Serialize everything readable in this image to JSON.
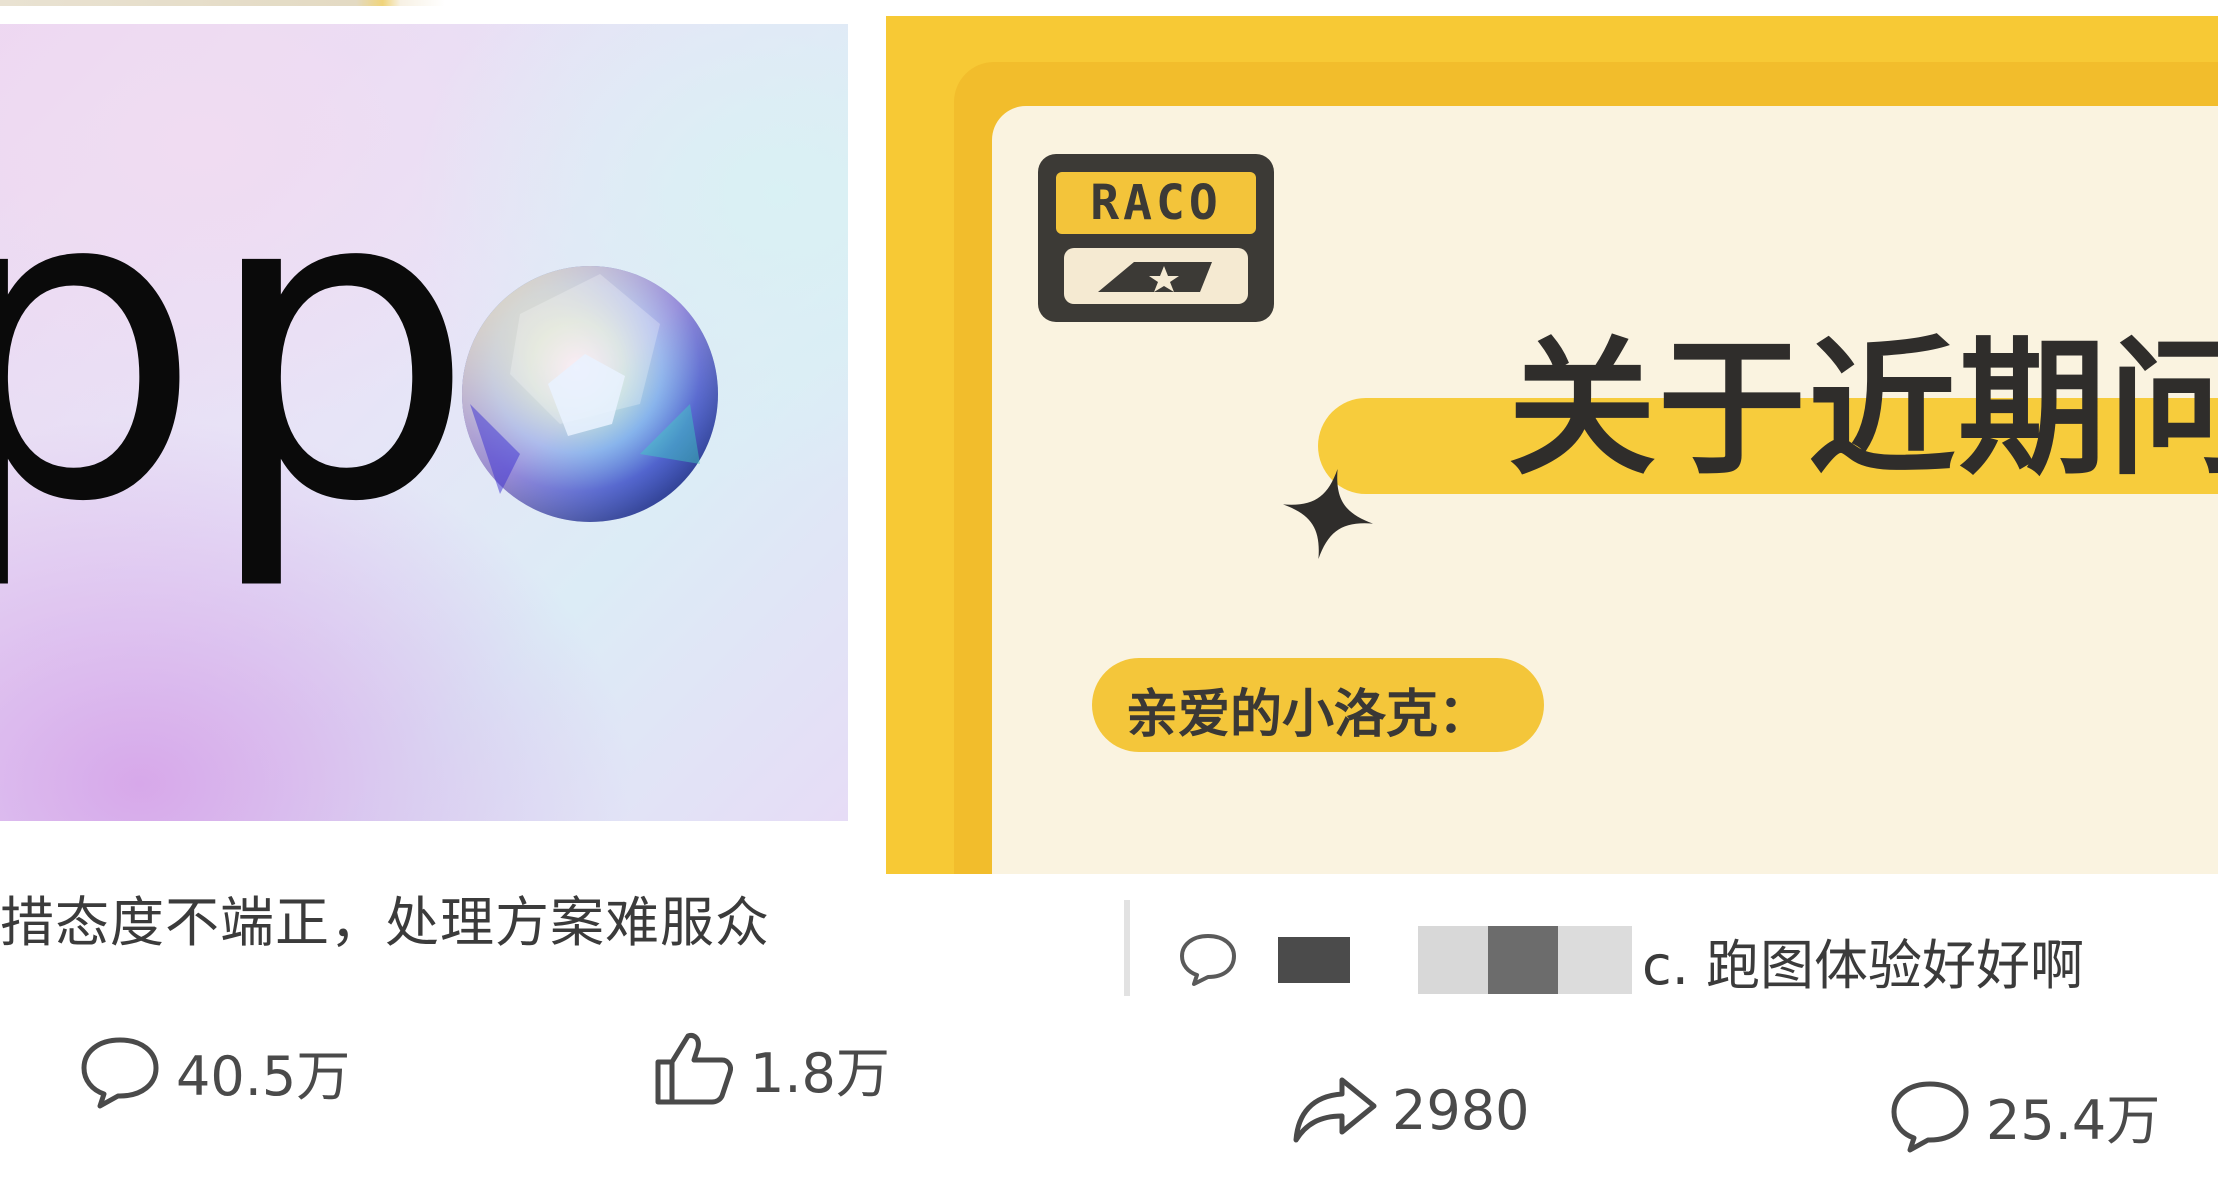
{
  "left_card": {
    "title_snippet": "措态度不端正，处理方案难服众",
    "cover_text": "pp",
    "comments_count": "40.5万",
    "likes_count": "1.8万"
  },
  "right_card": {
    "logo_text": "RACO",
    "headline": "关于近期问题",
    "greeting": "亲爱的小洛克：",
    "comment_preview": "c. 跑图体验好好啊",
    "shares_count": "2980",
    "comments_count": "25.4万"
  },
  "colors": {
    "brand_yellow": "#f7c935",
    "paper": "#faf3e0",
    "text_dark": "#3b3b3b",
    "icon_gray": "#4a4a4a"
  },
  "icons": [
    "comment-icon",
    "thumbs-up-icon",
    "share-icon",
    "sparkle-star-icon",
    "crystal-ball-icon"
  ]
}
